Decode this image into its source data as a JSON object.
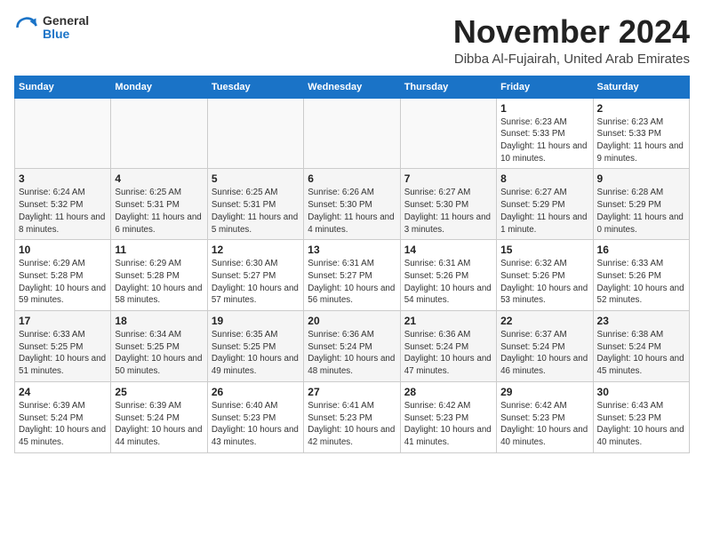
{
  "logo": {
    "general": "General",
    "blue": "Blue"
  },
  "header": {
    "title": "November 2024",
    "subtitle": "Dibba Al-Fujairah, United Arab Emirates"
  },
  "weekdays": [
    "Sunday",
    "Monday",
    "Tuesday",
    "Wednesday",
    "Thursday",
    "Friday",
    "Saturday"
  ],
  "rows": [
    [
      {
        "day": "",
        "empty": true
      },
      {
        "day": "",
        "empty": true
      },
      {
        "day": "",
        "empty": true
      },
      {
        "day": "",
        "empty": true
      },
      {
        "day": "",
        "empty": true
      },
      {
        "day": "1",
        "info": "Sunrise: 6:23 AM\nSunset: 5:33 PM\nDaylight: 11 hours and 10 minutes."
      },
      {
        "day": "2",
        "info": "Sunrise: 6:23 AM\nSunset: 5:33 PM\nDaylight: 11 hours and 9 minutes."
      }
    ],
    [
      {
        "day": "3",
        "info": "Sunrise: 6:24 AM\nSunset: 5:32 PM\nDaylight: 11 hours and 8 minutes."
      },
      {
        "day": "4",
        "info": "Sunrise: 6:25 AM\nSunset: 5:31 PM\nDaylight: 11 hours and 6 minutes."
      },
      {
        "day": "5",
        "info": "Sunrise: 6:25 AM\nSunset: 5:31 PM\nDaylight: 11 hours and 5 minutes."
      },
      {
        "day": "6",
        "info": "Sunrise: 6:26 AM\nSunset: 5:30 PM\nDaylight: 11 hours and 4 minutes."
      },
      {
        "day": "7",
        "info": "Sunrise: 6:27 AM\nSunset: 5:30 PM\nDaylight: 11 hours and 3 minutes."
      },
      {
        "day": "8",
        "info": "Sunrise: 6:27 AM\nSunset: 5:29 PM\nDaylight: 11 hours and 1 minute."
      },
      {
        "day": "9",
        "info": "Sunrise: 6:28 AM\nSunset: 5:29 PM\nDaylight: 11 hours and 0 minutes."
      }
    ],
    [
      {
        "day": "10",
        "info": "Sunrise: 6:29 AM\nSunset: 5:28 PM\nDaylight: 10 hours and 59 minutes."
      },
      {
        "day": "11",
        "info": "Sunrise: 6:29 AM\nSunset: 5:28 PM\nDaylight: 10 hours and 58 minutes."
      },
      {
        "day": "12",
        "info": "Sunrise: 6:30 AM\nSunset: 5:27 PM\nDaylight: 10 hours and 57 minutes."
      },
      {
        "day": "13",
        "info": "Sunrise: 6:31 AM\nSunset: 5:27 PM\nDaylight: 10 hours and 56 minutes."
      },
      {
        "day": "14",
        "info": "Sunrise: 6:31 AM\nSunset: 5:26 PM\nDaylight: 10 hours and 54 minutes."
      },
      {
        "day": "15",
        "info": "Sunrise: 6:32 AM\nSunset: 5:26 PM\nDaylight: 10 hours and 53 minutes."
      },
      {
        "day": "16",
        "info": "Sunrise: 6:33 AM\nSunset: 5:26 PM\nDaylight: 10 hours and 52 minutes."
      }
    ],
    [
      {
        "day": "17",
        "info": "Sunrise: 6:33 AM\nSunset: 5:25 PM\nDaylight: 10 hours and 51 minutes."
      },
      {
        "day": "18",
        "info": "Sunrise: 6:34 AM\nSunset: 5:25 PM\nDaylight: 10 hours and 50 minutes."
      },
      {
        "day": "19",
        "info": "Sunrise: 6:35 AM\nSunset: 5:25 PM\nDaylight: 10 hours and 49 minutes."
      },
      {
        "day": "20",
        "info": "Sunrise: 6:36 AM\nSunset: 5:24 PM\nDaylight: 10 hours and 48 minutes."
      },
      {
        "day": "21",
        "info": "Sunrise: 6:36 AM\nSunset: 5:24 PM\nDaylight: 10 hours and 47 minutes."
      },
      {
        "day": "22",
        "info": "Sunrise: 6:37 AM\nSunset: 5:24 PM\nDaylight: 10 hours and 46 minutes."
      },
      {
        "day": "23",
        "info": "Sunrise: 6:38 AM\nSunset: 5:24 PM\nDaylight: 10 hours and 45 minutes."
      }
    ],
    [
      {
        "day": "24",
        "info": "Sunrise: 6:39 AM\nSunset: 5:24 PM\nDaylight: 10 hours and 45 minutes."
      },
      {
        "day": "25",
        "info": "Sunrise: 6:39 AM\nSunset: 5:24 PM\nDaylight: 10 hours and 44 minutes."
      },
      {
        "day": "26",
        "info": "Sunrise: 6:40 AM\nSunset: 5:23 PM\nDaylight: 10 hours and 43 minutes."
      },
      {
        "day": "27",
        "info": "Sunrise: 6:41 AM\nSunset: 5:23 PM\nDaylight: 10 hours and 42 minutes."
      },
      {
        "day": "28",
        "info": "Sunrise: 6:42 AM\nSunset: 5:23 PM\nDaylight: 10 hours and 41 minutes."
      },
      {
        "day": "29",
        "info": "Sunrise: 6:42 AM\nSunset: 5:23 PM\nDaylight: 10 hours and 40 minutes."
      },
      {
        "day": "30",
        "info": "Sunrise: 6:43 AM\nSunset: 5:23 PM\nDaylight: 10 hours and 40 minutes."
      }
    ]
  ]
}
